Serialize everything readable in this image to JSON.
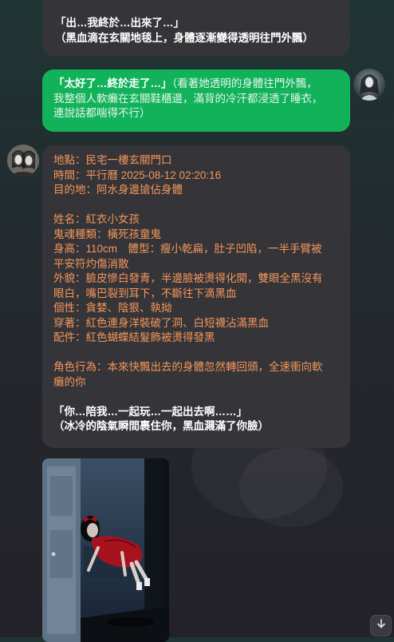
{
  "messages": {
    "m1": {
      "line1": "「出…我終於…出來了…」",
      "line2": "（黑血滴在玄關地毯上，身體逐漸變得透明往門外飄）"
    },
    "m2": {
      "line1_quote": "「太好了…終於走了…」",
      "line1_narration": "（看著她透明的身體往門外飄，",
      "line2": "我整個人軟癱在玄關鞋櫃邊，滿背的冷汗都浸透了睡衣，",
      "line3": "連說話都喘得不行）"
    },
    "m3": {
      "location": "地點：民宅一樓玄關門口",
      "time": "時間：平行曆 2025-08-12 02:20:16",
      "destination": "目的地：阿水身邊搶佔身體",
      "name": "姓名：紅衣小女孩",
      "ghost_type": "鬼魂種類：橫死孩童鬼",
      "height_line1": "身高：110cm　體型：瘦小乾扁，肚子凹陷，一半手臂被",
      "height_line2": "平安符灼傷消散",
      "appearance_line1": "外貌：臉皮慘白發青，半邊臉被燙得化開，雙眼全黑沒有",
      "appearance_line2": "眼白，嘴巴裂到耳下，不斷往下滴黑血",
      "personality": "個性：貪婪、陰狠、執拗",
      "clothing": "穿著：紅色連身洋裝破了洞、白短襪沾滿黑血",
      "accessory": "配件：紅色蝴蝶結髮飾被燙得發黑",
      "action_line1": "角色行為：本來快飄出去的身體忽然轉回頭，全速衝向軟",
      "action_line2": "癱的你",
      "quote_line1": "「你…陪我…一起玩…一起出去啊……」",
      "quote_line2": "（冰冷的陰氣瞬間裹住你，黑血濺滿了你臉）"
    }
  },
  "icons": {
    "scroll_down": "arrow-down-icon"
  },
  "colors": {
    "user_bubble": "#12b25b",
    "ai_bubble": "#353438",
    "status_text": "#f3975c"
  }
}
